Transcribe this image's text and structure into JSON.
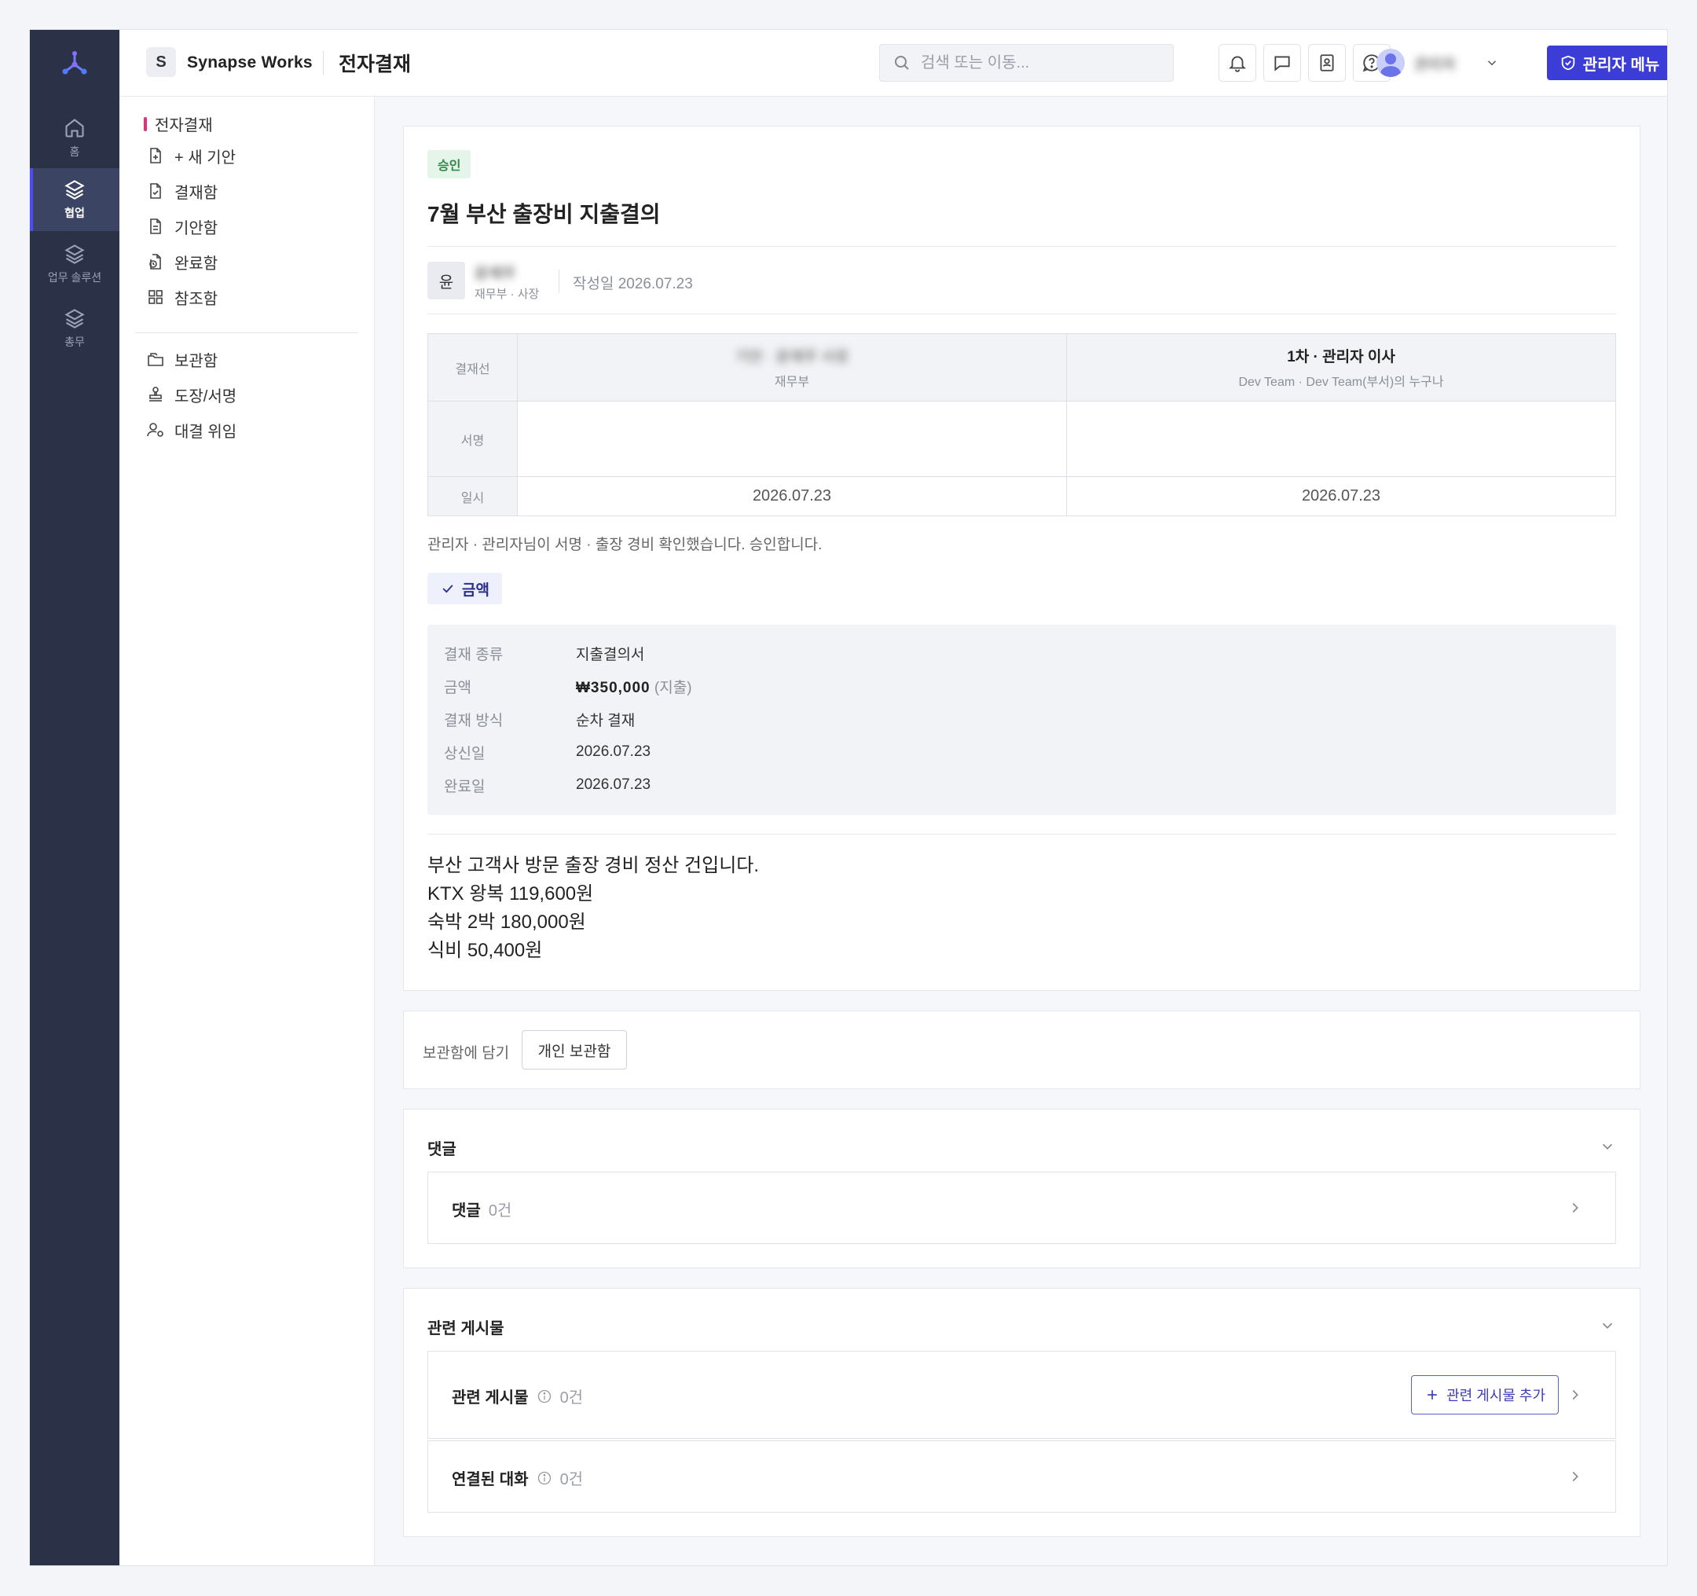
{
  "rail": {
    "items": [
      {
        "label": "홈",
        "icon": "home-icon"
      },
      {
        "label": "협업",
        "icon": "layers-icon",
        "active": true
      },
      {
        "label": "업무 솔루션",
        "icon": "layers-icon"
      },
      {
        "label": "총무",
        "icon": "layers-icon"
      }
    ]
  },
  "topbar": {
    "workspace_initial": "S",
    "workspace_name": "Synapse Works",
    "page_title": "전자결재",
    "search_placeholder": "검색 또는 이동...",
    "user_name": "관리자",
    "admin_button": "관리자 메뉴"
  },
  "sidebar": {
    "section_title": "전자결재",
    "items": [
      {
        "label": "+ 새 기안",
        "icon": "file-plus-icon"
      },
      {
        "label": "결재함",
        "icon": "file-check-icon"
      },
      {
        "label": "기안함",
        "icon": "file-text-icon"
      },
      {
        "label": "완료함",
        "icon": "file-clock-icon"
      },
      {
        "label": "참조함",
        "icon": "grid-icon"
      }
    ],
    "items2": [
      {
        "label": "보관함",
        "icon": "folder-icon"
      },
      {
        "label": "도장/서명",
        "icon": "stamp-icon"
      },
      {
        "label": "대결 위임",
        "icon": "user-delegate-icon"
      }
    ]
  },
  "document": {
    "status": "승인",
    "title": "7월 부산 출장비 지출결의",
    "author_initial": "윤",
    "author_name": "윤재무",
    "author_dept": "재무부 · 사장",
    "written_date": "작성일 2026.07.23",
    "approval": {
      "row_labels": [
        "결재선",
        "서명",
        "일시"
      ],
      "approvers": [
        {
          "name": "기안 · 윤재무 사장",
          "sub": "재무부",
          "date": "2026.07.23"
        },
        {
          "name": "1차 · 관리자 이사",
          "sub": "Dev Team · Dev Team(부서)의 누구나",
          "date": "2026.07.23"
        }
      ]
    },
    "note": "관리자 · 관리자님이 서명 · 출장 경비 확인했습니다. 승인합니다.",
    "amount_chip": "금액",
    "info": [
      {
        "key": "결재 종류",
        "value": "지출결의서"
      },
      {
        "key": "금액",
        "value": "₩350,000",
        "suffix": "(지출)"
      },
      {
        "key": "결재 방식",
        "value": "순차 결재"
      },
      {
        "key": "상신일",
        "value": "2026.07.23"
      },
      {
        "key": "완료일",
        "value": "2026.07.23"
      }
    ],
    "body": [
      "부산 고객사 방문 출장 경비 정산 건입니다.",
      "KTX 왕복 119,600원",
      "숙박 2박 180,000원",
      "식비 50,400원"
    ]
  },
  "archive": {
    "label": "보관함에 담기",
    "button": "개인 보관함"
  },
  "comments": {
    "section_title": "댓글",
    "row_title": "댓글",
    "count": "0건"
  },
  "related": {
    "section_title": "관련 게시물",
    "posts_title": "관련 게시물",
    "posts_count": "0건",
    "add_button": "관련 게시물 추가",
    "chats_title": "연결된 대화",
    "chats_count": "0건"
  }
}
